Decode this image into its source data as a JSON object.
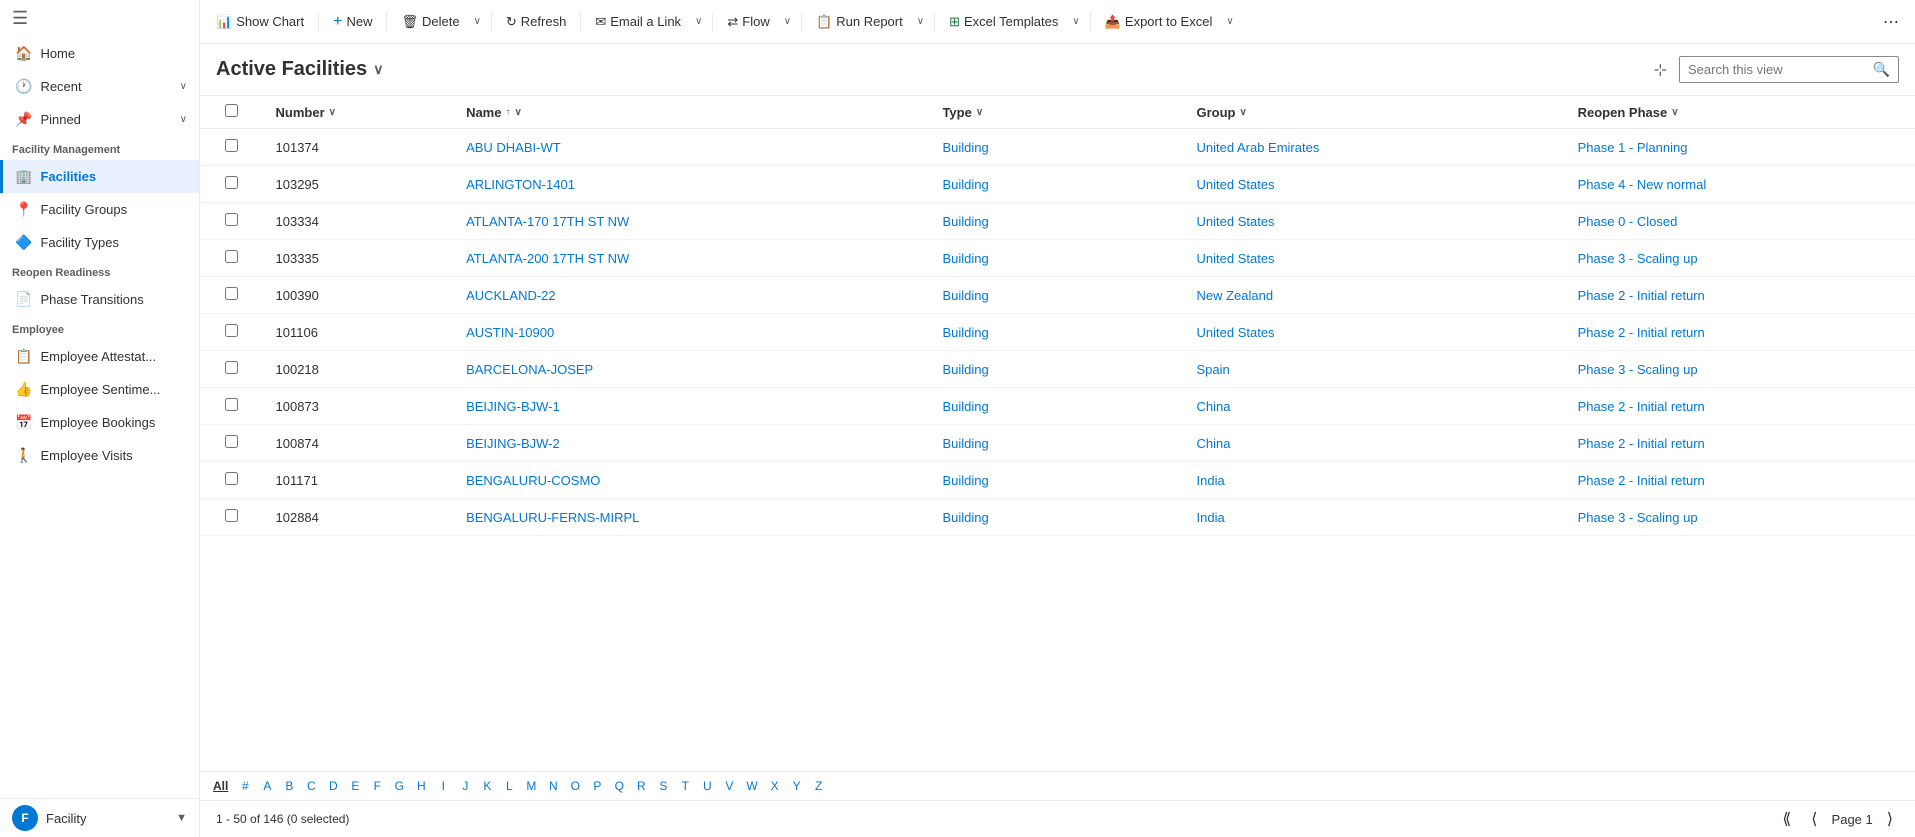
{
  "sidebar": {
    "menu_icon": "☰",
    "items": [
      {
        "id": "home",
        "label": "Home",
        "icon": "🏠",
        "hasChevron": false
      },
      {
        "id": "recent",
        "label": "Recent",
        "icon": "🕐",
        "hasChevron": true
      },
      {
        "id": "pinned",
        "label": "Pinned",
        "icon": "📌",
        "hasChevron": true
      }
    ],
    "sections": [
      {
        "title": "Facility Management",
        "items": [
          {
            "id": "facilities",
            "label": "Facilities",
            "icon": "🏢",
            "active": true
          },
          {
            "id": "facility-groups",
            "label": "Facility Groups",
            "icon": "📍"
          },
          {
            "id": "facility-types",
            "label": "Facility Types",
            "icon": "🔷"
          }
        ]
      },
      {
        "title": "Reopen Readiness",
        "items": [
          {
            "id": "phase-transitions",
            "label": "Phase Transitions",
            "icon": "📄"
          }
        ]
      },
      {
        "title": "Employee",
        "items": [
          {
            "id": "employee-attest",
            "label": "Employee Attestat...",
            "icon": "📋"
          },
          {
            "id": "employee-senti",
            "label": "Employee Sentime...",
            "icon": "👍"
          },
          {
            "id": "employee-bookings",
            "label": "Employee Bookings",
            "icon": "📅"
          },
          {
            "id": "employee-visits",
            "label": "Employee Visits",
            "icon": "🚶"
          }
        ]
      }
    ],
    "bottom": {
      "avatar_letter": "F",
      "label": "Facility",
      "chevron": "▼"
    }
  },
  "toolbar": {
    "show_chart_label": "Show Chart",
    "new_label": "New",
    "delete_label": "Delete",
    "refresh_label": "Refresh",
    "email_link_label": "Email a Link",
    "flow_label": "Flow",
    "run_report_label": "Run Report",
    "excel_templates_label": "Excel Templates",
    "export_excel_label": "Export to Excel"
  },
  "view": {
    "title": "Active Facilities",
    "search_placeholder": "Search this view"
  },
  "grid": {
    "columns": [
      {
        "id": "number",
        "label": "Number",
        "sortable": true,
        "sortDir": "asc"
      },
      {
        "id": "name",
        "label": "Name",
        "sortable": true,
        "sortDir": "asc"
      },
      {
        "id": "type",
        "label": "Type",
        "sortable": true
      },
      {
        "id": "group",
        "label": "Group",
        "sortable": true
      },
      {
        "id": "reopen_phase",
        "label": "Reopen Phase",
        "sortable": true
      }
    ],
    "rows": [
      {
        "number": "101374",
        "name": "ABU DHABI-WT",
        "type": "Building",
        "group": "United Arab Emirates",
        "reopen_phase": "Phase 1 - Planning"
      },
      {
        "number": "103295",
        "name": "ARLINGTON-1401",
        "type": "Building",
        "group": "United States",
        "reopen_phase": "Phase 4 - New normal"
      },
      {
        "number": "103334",
        "name": "ATLANTA-170 17TH ST NW",
        "type": "Building",
        "group": "United States",
        "reopen_phase": "Phase 0 - Closed"
      },
      {
        "number": "103335",
        "name": "ATLANTA-200 17TH ST NW",
        "type": "Building",
        "group": "United States",
        "reopen_phase": "Phase 3 - Scaling up"
      },
      {
        "number": "100390",
        "name": "AUCKLAND-22",
        "type": "Building",
        "group": "New Zealand",
        "reopen_phase": "Phase 2 - Initial return"
      },
      {
        "number": "101106",
        "name": "AUSTIN-10900",
        "type": "Building",
        "group": "United States",
        "reopen_phase": "Phase 2 - Initial return"
      },
      {
        "number": "100218",
        "name": "BARCELONA-JOSEP",
        "type": "Building",
        "group": "Spain",
        "reopen_phase": "Phase 3 - Scaling up"
      },
      {
        "number": "100873",
        "name": "BEIJING-BJW-1",
        "type": "Building",
        "group": "China",
        "reopen_phase": "Phase 2 - Initial return"
      },
      {
        "number": "100874",
        "name": "BEIJING-BJW-2",
        "type": "Building",
        "group": "China",
        "reopen_phase": "Phase 2 - Initial return"
      },
      {
        "number": "101171",
        "name": "BENGALURU-COSMO",
        "type": "Building",
        "group": "India",
        "reopen_phase": "Phase 2 - Initial return"
      },
      {
        "number": "102884",
        "name": "BENGALURU-FERNS-MIRPL",
        "type": "Building",
        "group": "India",
        "reopen_phase": "Phase 3 - Scaling up"
      }
    ]
  },
  "alpha_bar": {
    "items": [
      "All",
      "#",
      "A",
      "B",
      "C",
      "D",
      "E",
      "F",
      "G",
      "H",
      "I",
      "J",
      "K",
      "L",
      "M",
      "N",
      "O",
      "P",
      "Q",
      "R",
      "S",
      "T",
      "U",
      "V",
      "W",
      "X",
      "Y",
      "Z"
    ],
    "active": "All"
  },
  "footer": {
    "range_text": "1 - 50 of 146 (0 selected)",
    "page_label": "Page 1"
  }
}
